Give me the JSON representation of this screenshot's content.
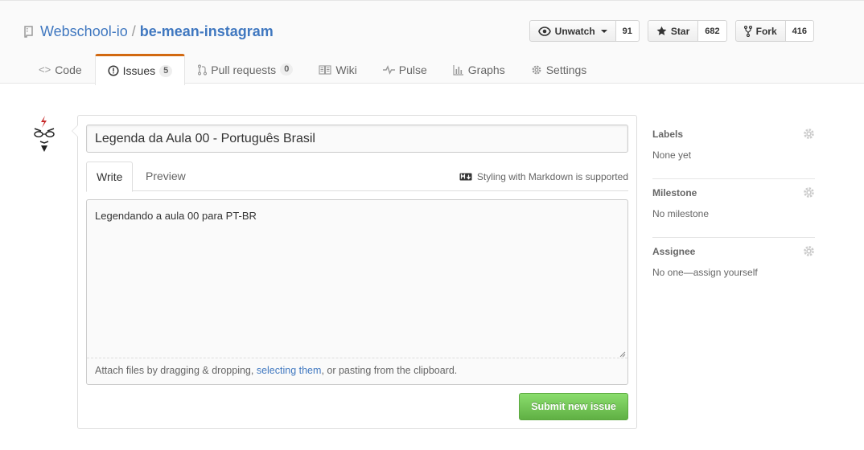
{
  "repo": {
    "owner": "Webschool-io",
    "separator": "/",
    "name": "be-mean-instagram"
  },
  "actions": {
    "watch": {
      "label": "Unwatch",
      "count": "91"
    },
    "star": {
      "label": "Star",
      "count": "682"
    },
    "fork": {
      "label": "Fork",
      "count": "416"
    }
  },
  "tabs": [
    {
      "label": "Code",
      "icon": "code-icon",
      "selected": false
    },
    {
      "label": "Issues",
      "counter": "5",
      "icon": "issue-opened-icon",
      "selected": true
    },
    {
      "label": "Pull requests",
      "counter": "0",
      "icon": "git-pull-request-icon",
      "selected": false
    },
    {
      "label": "Wiki",
      "icon": "book-icon",
      "selected": false
    },
    {
      "label": "Pulse",
      "icon": "pulse-icon",
      "selected": false
    },
    {
      "label": "Graphs",
      "icon": "graph-icon",
      "selected": false
    },
    {
      "label": "Settings",
      "icon": "gear-icon",
      "selected": false
    }
  ],
  "form": {
    "title_value": "Legenda da Aula 00 - Português Brasil",
    "write_tab": "Write",
    "preview_tab": "Preview",
    "markdown_hint": "Styling with Markdown is supported",
    "body_value": "Legendando a aula 00 para PT-BR",
    "attach_prefix": "Attach files by dragging & dropping, ",
    "attach_link": "selecting them",
    "attach_suffix": ", or pasting from the clipboard.",
    "submit_label": "Submit new issue"
  },
  "sidebar": {
    "labels": {
      "heading": "Labels",
      "value": "None yet"
    },
    "milestone": {
      "heading": "Milestone",
      "value": "No milestone"
    },
    "assignee": {
      "heading": "Assignee",
      "value": "No one—assign yourself"
    }
  },
  "colors": {
    "link": "#4078c0",
    "tab_accent": "#d26911",
    "submit_green": "#6cc644"
  }
}
